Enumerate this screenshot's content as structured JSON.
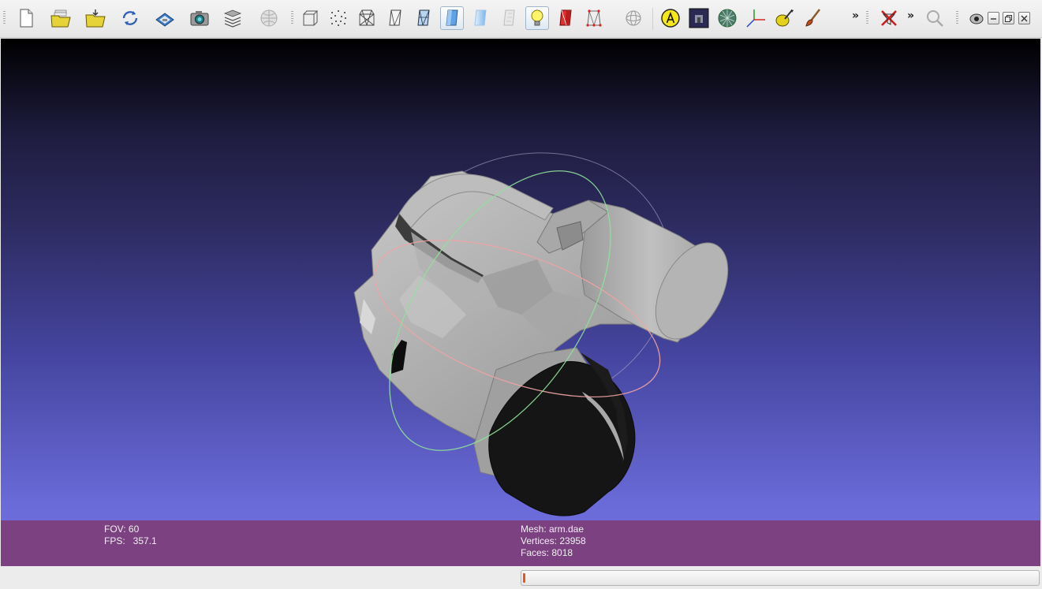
{
  "toolbar": {
    "icons": [
      "new-project-icon",
      "open-project-icon",
      "import-mesh-icon",
      "reload-icon",
      "save-snapshot-icon",
      "camera-icon",
      "layers-icon",
      "globe-disabled-icon",
      "bounding-box-icon",
      "points-icon",
      "wireframe-icon",
      "hidden-lines-icon",
      "flat-lines-icon",
      "flat-shading-icon",
      "smooth-shading-icon",
      "texture-icon",
      "light-bulb-icon",
      "backface-icon",
      "vertex-normals-icon",
      "trackball-icon",
      "annotation-icon",
      "background-image-icon",
      "sphere-render-icon",
      "axes-icon",
      "color-edit-icon",
      "paint-brush-icon",
      "disable-filter-icon",
      "search-icon",
      "eye-icon"
    ],
    "active": [
      "smooth-shading-icon",
      "light-bulb-icon"
    ],
    "extension_glyph": "»"
  },
  "window_controls": {
    "minimize": "window-minimize-icon",
    "restore": "window-restore-icon",
    "close": "window-close-icon"
  },
  "viewport": {
    "background_top": "#000000",
    "background_bottom": "#7070e0",
    "mesh_color": "#a8a8a8",
    "dark_part_color": "#151515",
    "trackball_colors": [
      "#8fe29a",
      "#f2a3a3",
      "#c8c8d8"
    ]
  },
  "info_panel": {
    "fov_line": "FOV: 60",
    "fps_line": "FPS:   357.1",
    "mesh_line": "Mesh: arm.dae",
    "vertices_line": "Vertices: 23958",
    "faces_line": "Faces: 8018",
    "background": "#7b4181"
  },
  "status_bar": {
    "progress": 0.0
  }
}
